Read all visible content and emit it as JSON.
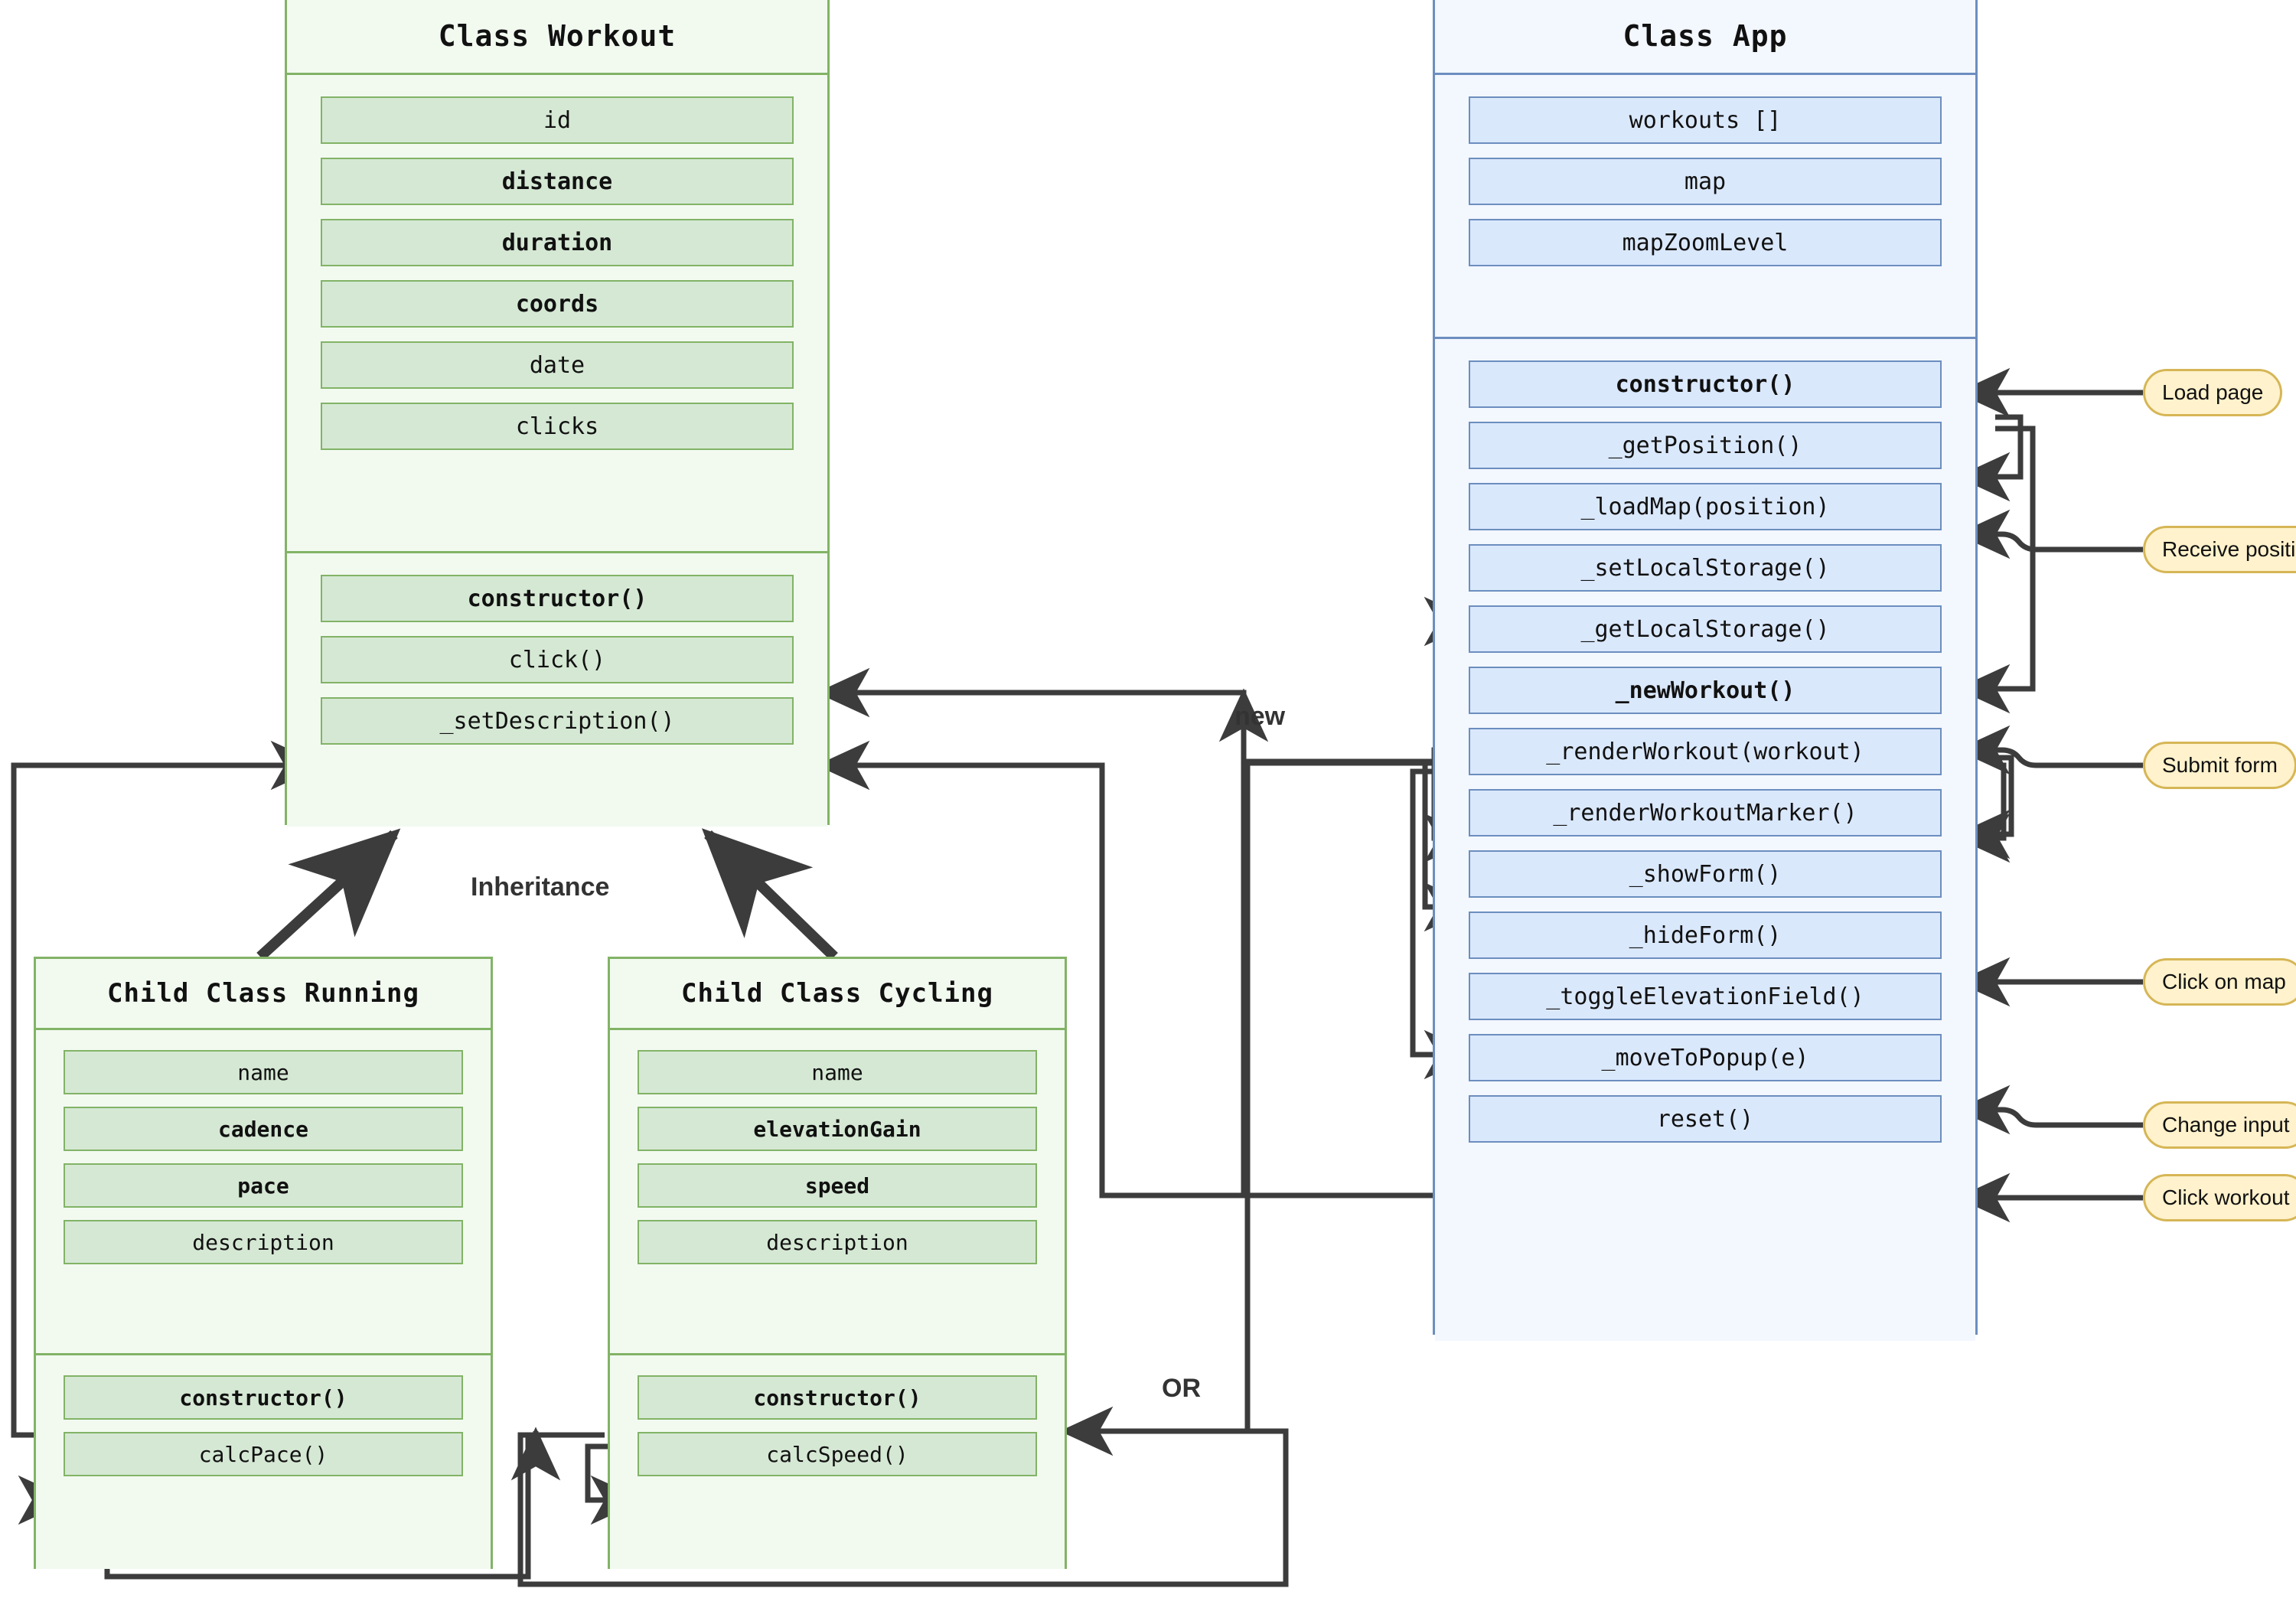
{
  "colors": {
    "green_border": "#82b366",
    "green_fill": "#d5e8d4",
    "green_bg": "#f2faf0",
    "blue_border": "#6c8ebf",
    "blue_fill": "#dae8fc",
    "blue_bg": "#f3f7fe",
    "callout_border": "#d6b656",
    "callout_fill": "#fff2cc",
    "wire": "#3c3c3c"
  },
  "classes": {
    "workout": {
      "title": "Class Workout",
      "attributes": [
        {
          "label": "id",
          "bold": false
        },
        {
          "label": "distance",
          "bold": true
        },
        {
          "label": "duration",
          "bold": true
        },
        {
          "label": "coords",
          "bold": true
        },
        {
          "label": "date",
          "bold": false
        },
        {
          "label": "clicks",
          "bold": false
        }
      ],
      "methods": [
        {
          "label": "constructor()",
          "bold": true
        },
        {
          "label": "click()",
          "bold": false
        },
        {
          "label": "_setDescription()",
          "bold": false
        }
      ]
    },
    "app": {
      "title": "Class App",
      "attributes": [
        {
          "label": "workouts []",
          "bold": false
        },
        {
          "label": "map",
          "bold": false
        },
        {
          "label": "mapZoomLevel",
          "bold": false
        }
      ],
      "methods": [
        {
          "label": "constructor()",
          "bold": true
        },
        {
          "label": "_getPosition()",
          "bold": false
        },
        {
          "label": "_loadMap(position)",
          "bold": false
        },
        {
          "label": "_setLocalStorage()",
          "bold": false
        },
        {
          "label": "_getLocalStorage()",
          "bold": false
        },
        {
          "label": "_newWorkout()",
          "bold": true
        },
        {
          "label": "_renderWorkout(workout)",
          "bold": false
        },
        {
          "label": "_renderWorkoutMarker()",
          "bold": false
        },
        {
          "label": "_showForm()",
          "bold": false
        },
        {
          "label": "_hideForm()",
          "bold": false
        },
        {
          "label": "_toggleElevationField()",
          "bold": false
        },
        {
          "label": "_moveToPopup(e)",
          "bold": false
        },
        {
          "label": "reset()",
          "bold": false
        }
      ]
    },
    "running": {
      "title": "Child Class Running",
      "attributes": [
        {
          "label": "name",
          "bold": false
        },
        {
          "label": "cadence",
          "bold": true
        },
        {
          "label": "pace",
          "bold": true
        },
        {
          "label": "description",
          "bold": false
        }
      ],
      "methods": [
        {
          "label": "constructor()",
          "bold": true
        },
        {
          "label": "calcPace()",
          "bold": false
        }
      ]
    },
    "cycling": {
      "title": "Child Class Cycling",
      "attributes": [
        {
          "label": "name",
          "bold": false
        },
        {
          "label": "elevationGain",
          "bold": true
        },
        {
          "label": "speed",
          "bold": true
        },
        {
          "label": "description",
          "bold": false
        }
      ],
      "methods": [
        {
          "label": "constructor()",
          "bold": true
        },
        {
          "label": "calcSpeed()",
          "bold": false
        }
      ]
    }
  },
  "callouts": [
    {
      "label": "Load page",
      "target": "constructor()"
    },
    {
      "label": "Receive position",
      "target": "_loadMap(position)"
    },
    {
      "label": "Submit form",
      "target": "_newWorkout()"
    },
    {
      "label": "Click on map",
      "target": "_showForm()"
    },
    {
      "label": "Change input",
      "target": "_toggleElevationField()"
    },
    {
      "label": "Click workout",
      "target": "_moveToPopup(e)"
    }
  ],
  "labels": {
    "inheritance": "Inheritance",
    "new": "new",
    "or": "OR"
  }
}
